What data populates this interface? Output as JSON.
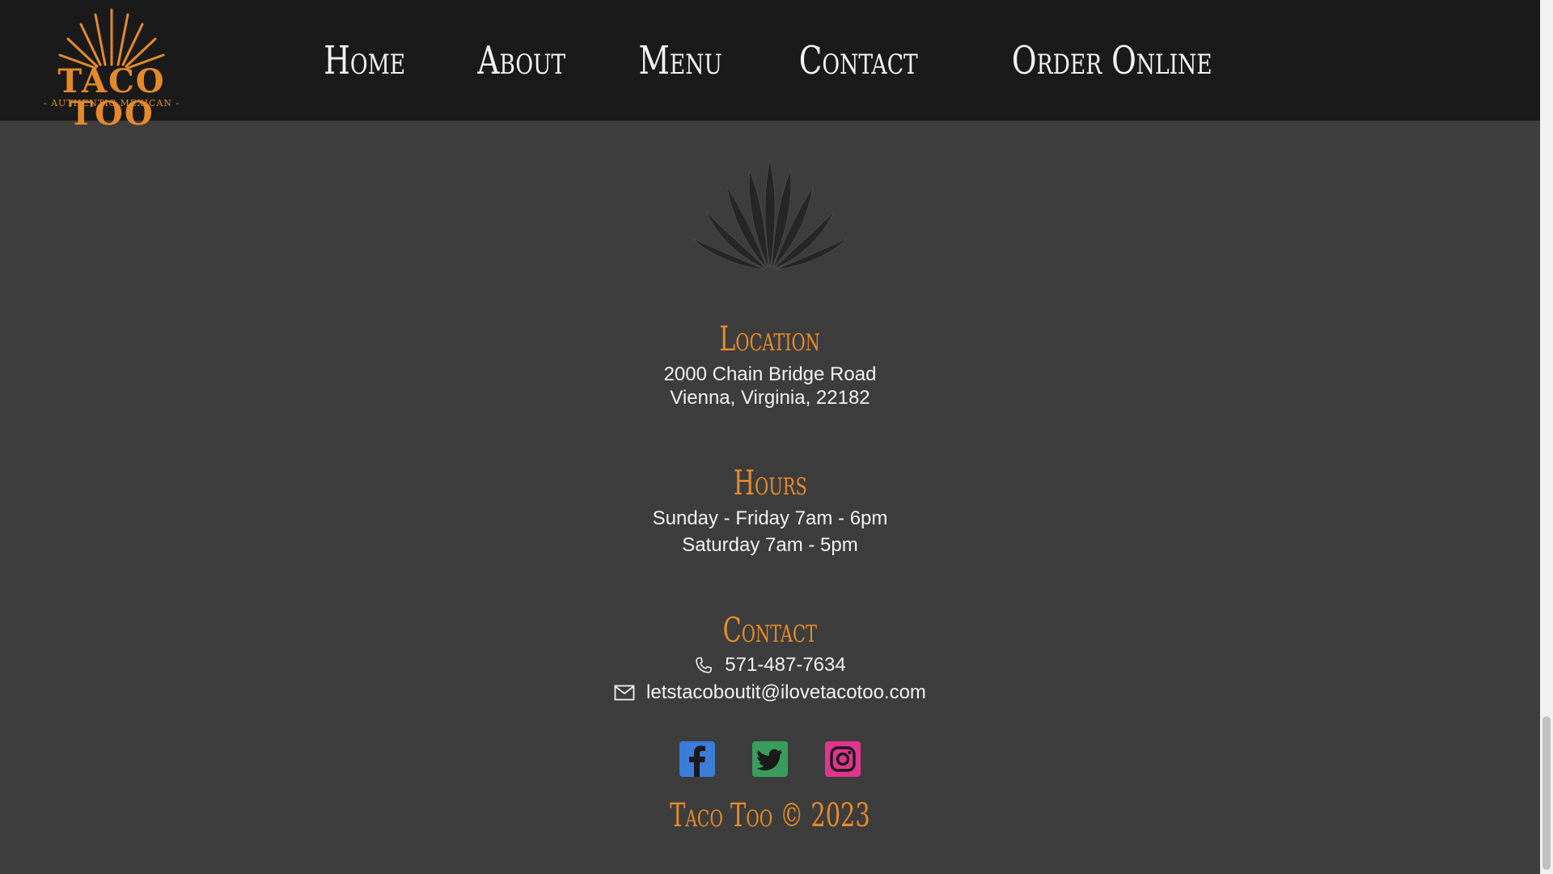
{
  "brand": {
    "name": "TACO TOO",
    "tagline": "- AUTHENTIC MEXICAN -",
    "color": "#e48a2a"
  },
  "nav": {
    "items": [
      {
        "label": "Home"
      },
      {
        "label": "About"
      },
      {
        "label": "Menu"
      },
      {
        "label": "Contact"
      },
      {
        "label": "Order Online"
      }
    ]
  },
  "location": {
    "title": "Location",
    "line1": "2000 Chain Bridge Road",
    "line2": "Vienna, Virginia, 22182"
  },
  "hours": {
    "title": "Hours",
    "line1": "Sunday - Friday 7am - 6pm",
    "line2": "Saturday 7am - 5pm"
  },
  "contact": {
    "title": "Contact",
    "phone": "571-487-7634",
    "email": "letstacoboutit@ilovetacotoo.com",
    "phone_icon": "phone-icon",
    "email_icon": "mail-icon"
  },
  "socials": [
    {
      "name": "facebook-icon",
      "color": "#3b7dd8"
    },
    {
      "name": "twitter-icon",
      "color": "#3a9d5d"
    },
    {
      "name": "instagram-icon",
      "color": "#e0358f"
    }
  ],
  "footer": {
    "copyright": "Taco Too © 2023"
  }
}
